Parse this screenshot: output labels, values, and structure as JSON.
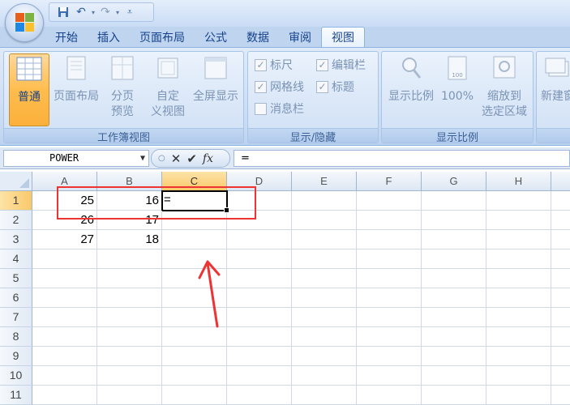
{
  "title_bar": {
    "quick_access": {
      "save_icon": "save-icon",
      "undo_icon": "undo-icon",
      "redo_icon": "redo-icon",
      "customize_icon": "dropdown-icon"
    }
  },
  "tabs": [
    {
      "label": "开始",
      "active": false
    },
    {
      "label": "插入",
      "active": false
    },
    {
      "label": "页面布局",
      "active": false
    },
    {
      "label": "公式",
      "active": false
    },
    {
      "label": "数据",
      "active": false
    },
    {
      "label": "审阅",
      "active": false
    },
    {
      "label": "视图",
      "active": true
    }
  ],
  "ribbon": {
    "workbook_views": {
      "label": "工作簿视图",
      "normal": "普通",
      "page_layout": "页面布局",
      "page_break_1": "分页",
      "page_break_2": "预览",
      "custom_1": "自定",
      "custom_2": "义视图",
      "fullscreen": "全屏显示"
    },
    "show_hide": {
      "label": "显示/隐藏",
      "ruler": "标尺",
      "formula_bar": "编辑栏",
      "gridlines": "网格线",
      "headings": "标题",
      "message_bar": "消息栏"
    },
    "zoom": {
      "label": "显示比例",
      "zoom": "显示比例",
      "hundred": "100%",
      "hundred_icon_text": "100",
      "zoom_selection_1": "缩放到",
      "zoom_selection_2": "选定区域"
    },
    "window": {
      "new_window": "新建窗"
    }
  },
  "formula_bar": {
    "name_box": "POWER",
    "formula": "="
  },
  "grid": {
    "columns": [
      "A",
      "B",
      "C",
      "D",
      "E",
      "F",
      "G",
      "H"
    ],
    "rows": [
      "1",
      "2",
      "3",
      "4",
      "5",
      "6",
      "7",
      "8",
      "9",
      "10",
      "11"
    ],
    "cells": {
      "A1": "25",
      "B1": "16",
      "C1": "=",
      "A2": "26",
      "B2": "17",
      "A3": "27",
      "B3": "18"
    },
    "active_cell": "C1"
  },
  "colors": {
    "annotation": "#e33333",
    "active_tab_border": "#8db2e3",
    "selected_header": "#f9c96a"
  }
}
